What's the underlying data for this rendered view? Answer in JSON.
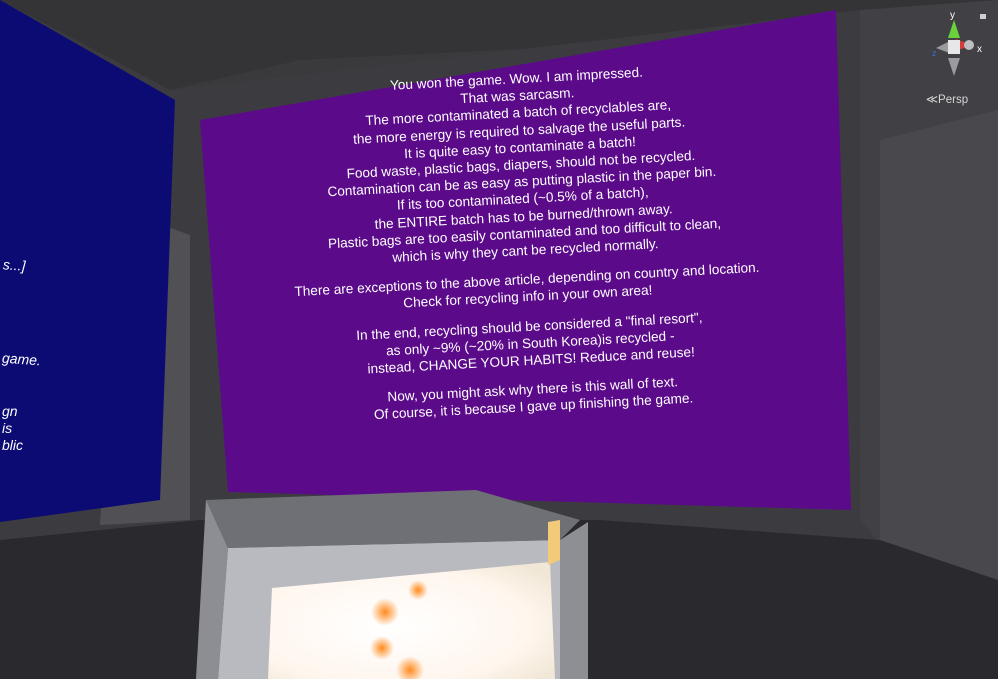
{
  "scene_view": {
    "projection_label": "Persp",
    "gizmo_axes": {
      "y": "y",
      "x": "x",
      "z": "z"
    },
    "colors": {
      "purple_panel": "#5b0a8a",
      "blue_panel": "#0c0b74",
      "room": "#3d3d41",
      "gizmo_y": "#6bd23b",
      "gizmo_x": "#d63b3b",
      "gizmo_z": "#3b6bd6"
    }
  },
  "purple_wall": {
    "lines": [
      "You won the game. Wow. I am impressed.",
      "That was sarcasm.",
      "The more contaminated a batch of recyclables are,",
      "the more energy is required to salvage the useful parts.",
      "It is quite easy to contaminate a batch!",
      "Food waste, plastic bags, diapers, should not be recycled.",
      "Contamination can be as easy as putting plastic in the paper bin.",
      "If its too contaminated (~0.5% of a batch),",
      "the ENTIRE batch has to be burned/thrown away.",
      "Plastic bags are too easily contaminated and too difficult to clean,",
      "which is why they cant be recycled normally.",
      "",
      "There are exceptions to the above article, depending on country and location.",
      "Check for recycling info in your own area!",
      "",
      "In the end, recycling should be considered a \"final resort\",",
      "as only ~9% (~20% in South Korea)is recycled -",
      "instead, CHANGE YOUR HABITS! Reduce and reuse!",
      "",
      "Now, you might ask why there is this wall of text.",
      "Of course, it is because I gave up finishing the game."
    ]
  },
  "blue_wall": {
    "fragments": [
      "s...]",
      "game.",
      "gn",
      "is",
      "blic"
    ]
  }
}
